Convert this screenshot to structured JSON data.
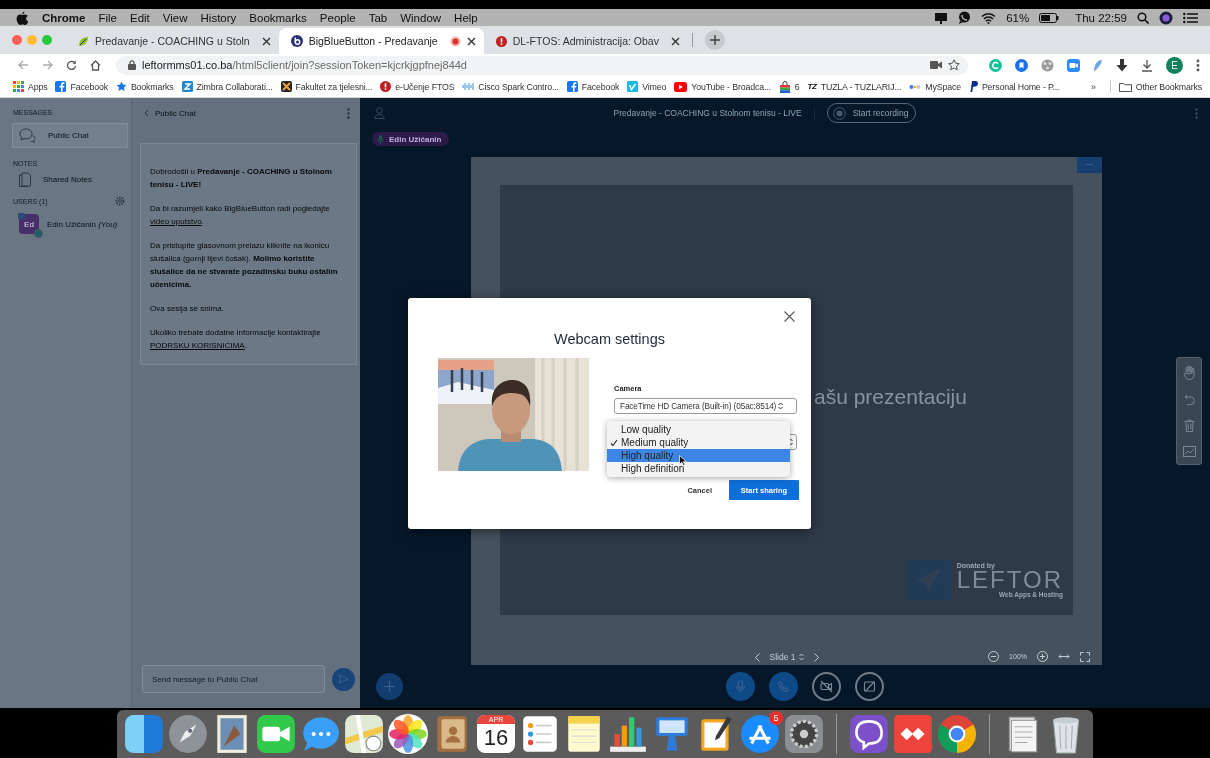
{
  "menu_bar": {
    "menus": [
      {
        "label": "Chrome",
        "kind": "app"
      },
      {
        "label": "File",
        "kind": "menu"
      },
      {
        "label": "Edit",
        "kind": "menu"
      },
      {
        "label": "View",
        "kind": "menu"
      },
      {
        "label": "History",
        "kind": "menu"
      },
      {
        "label": "Bookmarks",
        "kind": "menu"
      },
      {
        "label": "People",
        "kind": "menu"
      },
      {
        "label": "Tab",
        "kind": "menu"
      },
      {
        "label": "Window",
        "kind": "menu"
      },
      {
        "label": "Help",
        "kind": "menu"
      }
    ],
    "battery": "61%",
    "clock": "Thu 22:59"
  },
  "browser": {
    "tabs": [
      {
        "label": "Predavanje - COACHING u Stoln",
        "kind": "leaf",
        "selected": false,
        "recording": false
      },
      {
        "label": "BigBlueButton - Predavanje",
        "kind": "bbb",
        "selected": true,
        "recording": true
      },
      {
        "label": "DL-FTOS: Administracija: Obav",
        "kind": "alert",
        "selected": false,
        "recording": false
      }
    ],
    "address": {
      "host": "leftormms01.co.ba",
      "path": "/html5client/join?sessionToken=kjcrkjgpfnej844d"
    },
    "profile": "E",
    "bookmarks": [
      {
        "label": "Apps",
        "kind": "grid"
      },
      {
        "label": "Facebook",
        "kind": "fb"
      },
      {
        "label": "Bookmarks",
        "kind": "star"
      },
      {
        "label": "Zimbra Collaborati...",
        "kind": "zimbra"
      },
      {
        "label": "Fakultet za tjelesni...",
        "kind": "dark"
      },
      {
        "label": "e-Učenje FTOS",
        "kind": "alert"
      },
      {
        "label": "Cisco Spark Contro...",
        "kind": "bars"
      },
      {
        "label": "Facebook",
        "kind": "fb"
      },
      {
        "label": "Vimeo",
        "kind": "vimeo"
      },
      {
        "label": "YouTube - Broadca...",
        "kind": "play"
      },
      {
        "label": "6",
        "kind": "bag"
      },
      {
        "label": "TUZLA - TUZLARIJ...",
        "kind": "text",
        "icon_text": "TZ"
      },
      {
        "label": "MySpace",
        "kind": "dots"
      },
      {
        "label": "Personal Home - P...",
        "kind": "flag"
      }
    ],
    "overflow": "»",
    "other_bookmarks": "Other Bookmarks"
  },
  "sidebar": {
    "messages_heading": "MESSAGES",
    "chats": [
      {
        "label": "Public Chat",
        "selected": true
      }
    ],
    "notes_heading": "NOTES",
    "notes": [
      {
        "label": "Shared Notes"
      }
    ],
    "users_heading": "USERS (1)",
    "users": [
      {
        "initials": "Ed",
        "name": "Edin Užičanin *(You)*"
      }
    ]
  },
  "chat": {
    "title": "Public Chat",
    "welcome": [
      [
        {
          "kind": "text",
          "text": "Dobrodošli u **Predavanje - COACHING u Stolnom tenisu - LIVE!**"
        }
      ],
      [
        {
          "kind": "text",
          "text": "Da bi razumjeli kako BigBlueButton radi pogledajte "
        },
        {
          "kind": "link",
          "text": "video uputstvo"
        },
        {
          "kind": "text",
          "text": "."
        }
      ],
      [
        {
          "kind": "text",
          "text": "Da pristupite glasovnom prelazu kliknite na ikonicu slušalica (gornji lijevi čošak). **Molimo koristite slušalice da ne stvarate pozadinsku buku ostalim učenicima.**"
        }
      ],
      [
        {
          "kind": "text",
          "text": "Ova sesija se snima."
        }
      ],
      [
        {
          "kind": "text",
          "text": "Ukoliko trebate dodatne informacije kontaktirajte "
        },
        {
          "kind": "link",
          "text": "PODRSKU KORISNICIMA"
        },
        {
          "kind": "text",
          "text": "."
        }
      ]
    ],
    "input_placeholder": "Send message to Public Chat"
  },
  "main": {
    "title": "Predavanje - COACHING u Stolnom tenisu - LIVE",
    "record_label": "Start recording",
    "talking": "Edin Užičanin",
    "slide_text": "ašu prezentaciju",
    "slide_label": "Slide 1",
    "zoom_level": "100%",
    "logo": {
      "caption": "Donated by",
      "name": "LEFTOR",
      "tagline": "Web Apps & Hosting"
    },
    "controls": [
      {
        "kind": "mic",
        "active": true
      },
      {
        "kind": "phone",
        "active": true
      },
      {
        "kind": "camera",
        "active": false
      },
      {
        "kind": "screen",
        "active": false
      }
    ]
  },
  "modal": {
    "title": "Webcam settings",
    "camera_label": "Camera",
    "camera_value": "FaceTime HD Camera (Built-in) (05ac:8514)",
    "quality_options": [
      {
        "label": "Low quality",
        "checked": false,
        "highlighted": false
      },
      {
        "label": "Medium quality",
        "checked": true,
        "highlighted": false
      },
      {
        "label": "High quality",
        "checked": false,
        "highlighted": true
      },
      {
        "label": "High definition",
        "checked": false,
        "highlighted": false
      }
    ],
    "cancel": "Cancel",
    "confirm": "Start sharing"
  },
  "dock": {
    "apps": [
      {
        "kind": "finder"
      },
      {
        "kind": "rocket"
      },
      {
        "kind": "stamp"
      },
      {
        "kind": "facetime"
      },
      {
        "kind": "messages"
      },
      {
        "kind": "maps"
      },
      {
        "kind": "photos"
      },
      {
        "kind": "contacts"
      },
      {
        "kind": "calendar",
        "month": "APR",
        "day": "16"
      },
      {
        "kind": "reminders"
      },
      {
        "kind": "notes"
      },
      {
        "kind": "numbers"
      },
      {
        "kind": "keynote"
      },
      {
        "kind": "pages"
      },
      {
        "kind": "appstore",
        "badge": "5"
      },
      {
        "kind": "prefs"
      },
      {
        "kind": "separator"
      },
      {
        "kind": "viber"
      },
      {
        "kind": "anydesk"
      },
      {
        "kind": "chrome"
      },
      {
        "kind": "separator"
      },
      {
        "kind": "documents"
      },
      {
        "kind": "trash"
      }
    ]
  }
}
